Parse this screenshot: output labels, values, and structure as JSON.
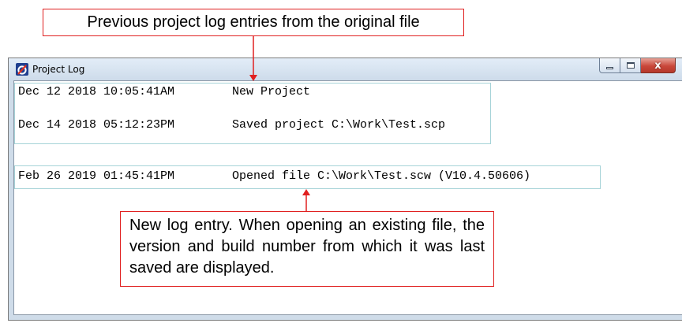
{
  "window": {
    "title": "Project Log",
    "minimize_label": "",
    "maximize_label": "",
    "close_label": "x"
  },
  "log_entries": [
    {
      "timestamp": "Dec 12 2018 10:05:41AM",
      "message": "New Project"
    },
    {
      "timestamp": "Dec 14 2018 05:12:23PM",
      "message": "Saved project C:\\Work\\Test.scp"
    },
    {
      "timestamp": "Feb 26 2019 01:45:41PM",
      "message": "Opened file C:\\Work\\Test.scw (V10.4.50606)"
    }
  ],
  "callouts": {
    "previous_entries": "Previous project log entries from the original file",
    "new_entry": "New log entry. When opening an existing file, the version and build number from which it was last saved are displayed."
  },
  "colors": {
    "callout_border": "#e02020",
    "highlight_border": "#a6d3d8",
    "window_frame": "#cfdce9",
    "close_button": "#c9473a"
  }
}
